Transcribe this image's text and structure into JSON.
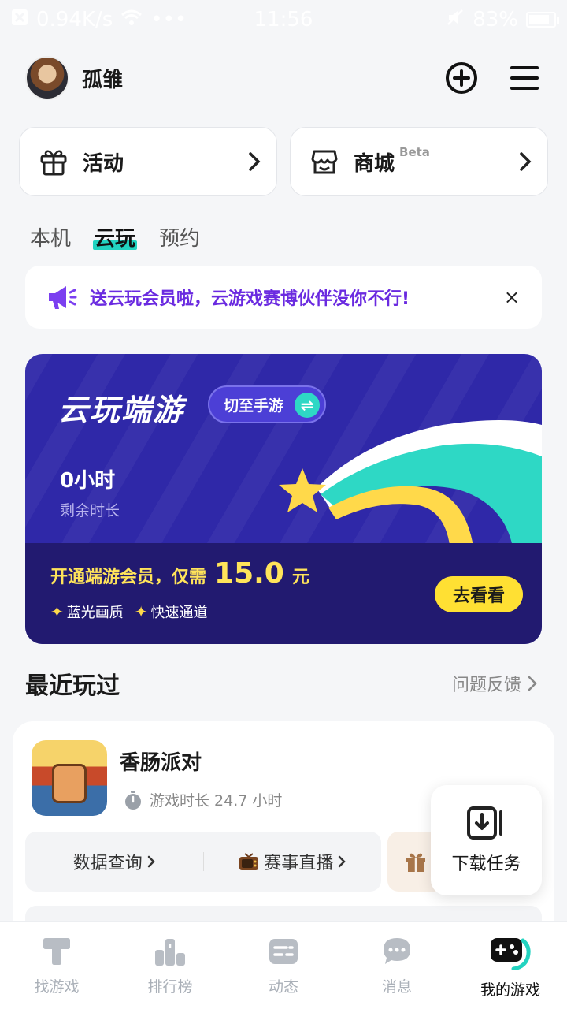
{
  "status_bar": {
    "net_speed": "0.94K/s",
    "dots": "•••",
    "time": "11:56",
    "battery": "83%",
    "battery_level": 0.83
  },
  "header": {
    "username": "孤雏"
  },
  "quick_links": [
    {
      "label": "活动",
      "badge": ""
    },
    {
      "label": "商城",
      "badge": "Beta"
    }
  ],
  "tabs": [
    "本机",
    "云玩",
    "预约"
  ],
  "active_tab": "云玩",
  "notice": {
    "text": "送云玩会员啦，云游戏赛博伙伴没你不行!",
    "close": "×"
  },
  "banner": {
    "title": "云玩端游",
    "switch_label": "切至手游",
    "hours": "0小时",
    "hours_label": "剩余时长",
    "offer_prefix": "开通端游会员，仅需",
    "price": "15.0",
    "unit": "元",
    "perks": [
      "蓝光画质",
      "快速通道"
    ],
    "cta": "去看看"
  },
  "recent": {
    "title": "最近玩过",
    "feedback": "问题反馈"
  },
  "game": {
    "name": "香肠派对",
    "playtime": "游戏时长 24.7 小时",
    "actions": [
      "数据查询",
      "赛事直播"
    ]
  },
  "download": {
    "label": "下载任务"
  },
  "tabbar": [
    {
      "label": "找游戏",
      "icon": "find-game-icon"
    },
    {
      "label": "排行榜",
      "icon": "ranking-icon"
    },
    {
      "label": "动态",
      "icon": "feed-icon"
    },
    {
      "label": "消息",
      "icon": "message-icon"
    },
    {
      "label": "我的游戏",
      "icon": "my-games-icon"
    }
  ],
  "active_tabbar": "我的游戏",
  "colors": {
    "accent": "#22d3c0",
    "banner_bg": "#2f28a8",
    "price": "#ffe45a",
    "cta": "#ffe033",
    "notice_text": "#6a2ae0"
  }
}
